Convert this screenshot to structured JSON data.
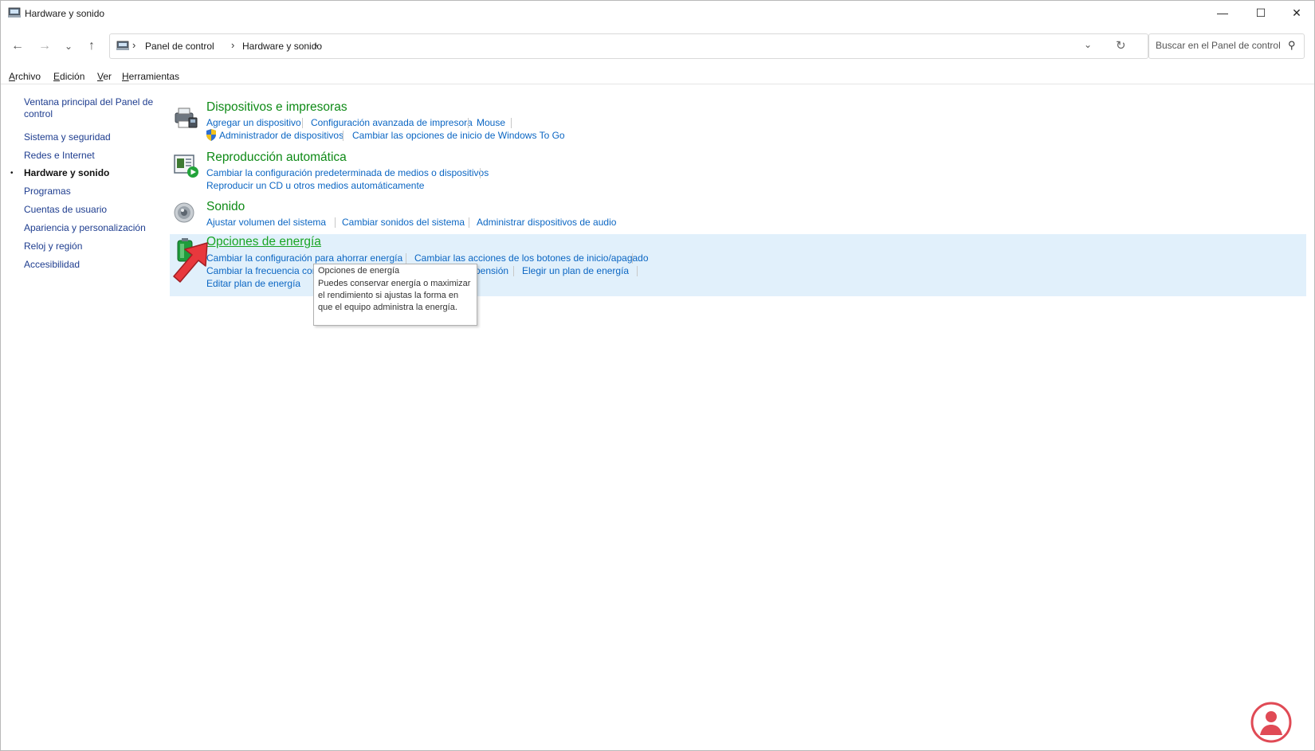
{
  "window": {
    "title": "Hardware y sonido",
    "controls": {
      "minimize": "—",
      "maximize": "☐",
      "close": "✕"
    }
  },
  "nav": {
    "back_icon": "←",
    "forward_icon": "→",
    "recent_icon": "⌄",
    "up_icon": "↑"
  },
  "address": {
    "separator": "›",
    "crumbs": [
      "Panel de control",
      "Hardware y sonido"
    ],
    "dropdown_icon": "⌄",
    "refresh_icon": "↻"
  },
  "search": {
    "placeholder": "Buscar en el Panel de control",
    "icon": "⚲"
  },
  "menu": [
    {
      "first": "A",
      "rest": "rchivo"
    },
    {
      "first": "E",
      "rest": "dición"
    },
    {
      "first": "V",
      "rest": "er"
    },
    {
      "first": "H",
      "rest": "erramientas"
    }
  ],
  "sidebar": {
    "items": [
      {
        "label": "Ventana principal del Panel de control"
      },
      {
        "label": "Sistema y seguridad"
      },
      {
        "label": "Redes e Internet"
      },
      {
        "label": "Hardware y sonido",
        "current": true
      },
      {
        "label": "Programas"
      },
      {
        "label": "Cuentas de usuario"
      },
      {
        "label": "Apariencia y personalización"
      },
      {
        "label": "Reloj y región"
      },
      {
        "label": "Accesibilidad"
      }
    ],
    "bullet": "•"
  },
  "sections": [
    {
      "heading": "Dispositivos e impresoras",
      "icon": "printer-icon",
      "links": [
        "Agregar un dispositivo",
        "Configuración avanzada de impresora",
        "Mouse",
        "Administrador de dispositivos",
        "Cambiar las opciones de inicio de Windows To Go"
      ]
    },
    {
      "heading": "Reproducción automática",
      "icon": "autoplay-icon",
      "links": [
        "Cambiar la configuración predeterminada de medios o dispositivos",
        "Reproducir un CD u otros medios automáticamente"
      ]
    },
    {
      "heading": "Sonido",
      "icon": "speaker-icon",
      "links": [
        "Ajustar volumen del sistema",
        "Cambiar sonidos del sistema",
        "Administrar dispositivos de audio"
      ]
    },
    {
      "heading": "Opciones de energía",
      "icon": "battery-icon",
      "links": [
        "Cambiar la configuración para ahorrar energía",
        "Cambiar las acciones de los botones de inicio/apagado",
        "Cambiar la frecuencia con",
        "pensión",
        "Elegir un plan de energía",
        "Editar plan de energía"
      ]
    }
  ],
  "tooltip": {
    "title": "Opciones de energía",
    "body": "Puedes conservar energía o maximizar el rendimiento si ajustas la forma en que el equipo administra la energía."
  },
  "colors": {
    "heading_green": "#0e8a16",
    "link_blue": "#0b66c3",
    "highlight_bg": "#e1f0fb",
    "pointer_red": "#e8383d"
  }
}
